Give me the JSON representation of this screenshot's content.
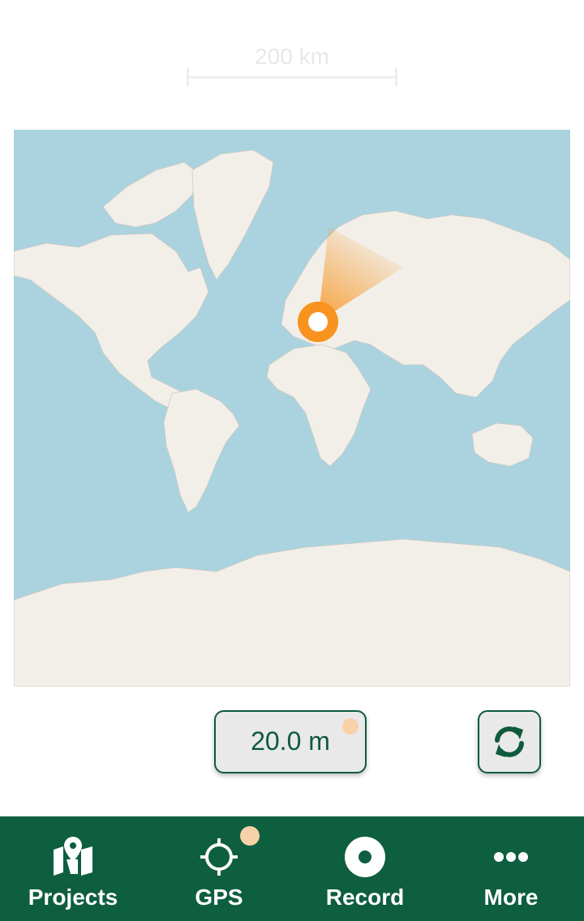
{
  "scale": {
    "label": "200 km"
  },
  "accuracy": {
    "value": "20.0 m"
  },
  "icons": {
    "sync": "sync-icon",
    "projects": "map-pin-icon",
    "gps": "crosshair-icon",
    "record": "record-icon",
    "more": "more-dots-icon"
  },
  "nav": {
    "items": [
      {
        "label": "Projects"
      },
      {
        "label": "GPS"
      },
      {
        "label": "Record"
      },
      {
        "label": "More"
      }
    ]
  },
  "colors": {
    "brand": "#0e5e40",
    "accent": "#f7931e",
    "water": "#aad3df",
    "land": "#f2efe9"
  }
}
